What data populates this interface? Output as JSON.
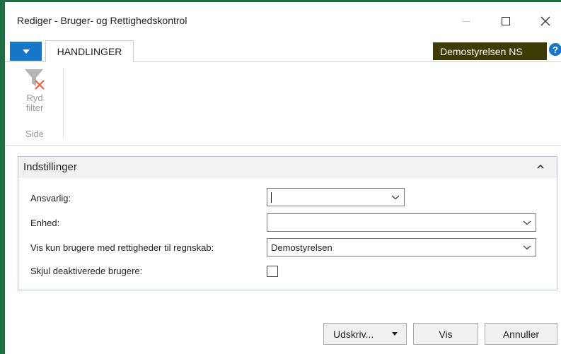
{
  "window": {
    "title": "Rediger - Bruger- og Rettighedskontrol"
  },
  "ribbon": {
    "tab_label": "HANDLINGER",
    "company": "Demostyrelsen NS",
    "help_symbol": "?",
    "clear_filter_line1": "Ryd",
    "clear_filter_line2": "filter",
    "group_label": "Side"
  },
  "panel": {
    "title": "Indstillinger",
    "fields": {
      "ansvarlig_label": "Ansvarlig:",
      "ansvarlig_value": "",
      "enhed_label": "Enhed:",
      "enhed_value": "",
      "regnskab_label": "Vis kun brugere med rettigheder til regnskab:",
      "regnskab_value": "Demostyrelsen",
      "skjul_label": "Skjul deaktiverede brugere:",
      "skjul_checked": false
    }
  },
  "buttons": {
    "print_label": "Udskriv...",
    "show_label": "Vis",
    "cancel_label": "Annuller"
  },
  "colors": {
    "window_border": "#1f6e43",
    "accent_blue": "#1876c9",
    "company_badge": "#3d3c06",
    "panel_border": "#a9c8ea"
  },
  "icons": {
    "app_menu": "chevron-down-icon",
    "clear_filter": "clear-filter-icon",
    "collapse": "chevron-up-icon",
    "dropdown": "chevron-down-icon",
    "help": "help-icon"
  }
}
